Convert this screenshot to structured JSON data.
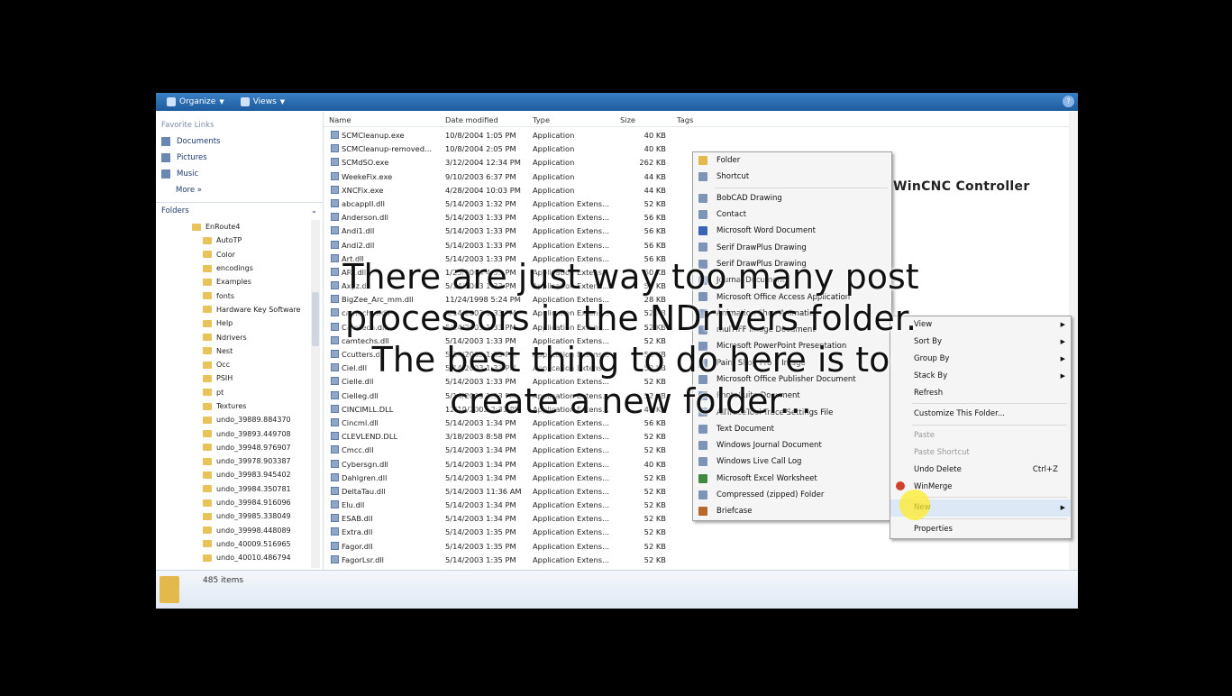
{
  "toolbar": {
    "organize": "Organize",
    "views": "Views",
    "help": "?"
  },
  "nav": {
    "favorite_links_label": "Favorite Links",
    "favorites": [
      "Documents",
      "Pictures",
      "Music"
    ],
    "more": "More »",
    "folders_label": "Folders",
    "tree": [
      {
        "label": "EnRoute4",
        "depth": 0
      },
      {
        "label": "AutoTP",
        "depth": 1
      },
      {
        "label": "Color",
        "depth": 1
      },
      {
        "label": "encodings",
        "depth": 1
      },
      {
        "label": "Examples",
        "depth": 1
      },
      {
        "label": "fonts",
        "depth": 1
      },
      {
        "label": "Hardware Key Software",
        "depth": 1
      },
      {
        "label": "Help",
        "depth": 1
      },
      {
        "label": "Ndrivers",
        "depth": 1
      },
      {
        "label": "Nest",
        "depth": 1
      },
      {
        "label": "Occ",
        "depth": 1
      },
      {
        "label": "PSIH",
        "depth": 1
      },
      {
        "label": "pt",
        "depth": 1
      },
      {
        "label": "Textures",
        "depth": 1
      },
      {
        "label": "undo_39889.884370",
        "depth": 1
      },
      {
        "label": "undo_39893.449708",
        "depth": 1
      },
      {
        "label": "undo_39948.976907",
        "depth": 1
      },
      {
        "label": "undo_39978.903387",
        "depth": 1
      },
      {
        "label": "undo_39983.945402",
        "depth": 1
      },
      {
        "label": "undo_39984.350781",
        "depth": 1
      },
      {
        "label": "undo_39984.916096",
        "depth": 1
      },
      {
        "label": "undo_39985.338049",
        "depth": 1
      },
      {
        "label": "undo_39998.448089",
        "depth": 1
      },
      {
        "label": "undo_40009.516965",
        "depth": 1
      },
      {
        "label": "undo_40010.486794",
        "depth": 1
      }
    ]
  },
  "columns": {
    "name": "Name",
    "date": "Date modified",
    "type": "Type",
    "size": "Size",
    "tags": "Tags"
  },
  "files": [
    {
      "name": "SCMCleanup.exe",
      "date": "10/8/2004 1:05 PM",
      "type": "Application",
      "size": "40 KB"
    },
    {
      "name": "SCMCleanup-removed...",
      "date": "10/8/2004 2:05 PM",
      "type": "Application",
      "size": "40 KB"
    },
    {
      "name": "SCMdSO.exe",
      "date": "3/12/2004 12:34 PM",
      "type": "Application",
      "size": "262 KB"
    },
    {
      "name": "WeekeFix.exe",
      "date": "9/10/2003 6:37 PM",
      "type": "Application",
      "size": "44 KB"
    },
    {
      "name": "XNCFix.exe",
      "date": "4/28/2004 10:03 PM",
      "type": "Application",
      "size": "44 KB"
    },
    {
      "name": "abcappII.dll",
      "date": "5/14/2003 1:32 PM",
      "type": "Application Extens...",
      "size": "52 KB"
    },
    {
      "name": "Anderson.dll",
      "date": "5/14/2003 1:33 PM",
      "type": "Application Extens...",
      "size": "56 KB"
    },
    {
      "name": "Andi1.dll",
      "date": "5/14/2003 1:33 PM",
      "type": "Application Extens...",
      "size": "56 KB"
    },
    {
      "name": "Andi2.dll",
      "date": "5/14/2003 1:33 PM",
      "type": "Application Extens...",
      "size": "56 KB"
    },
    {
      "name": "Art.dll",
      "date": "5/14/2003 1:33 PM",
      "type": "Application Extens...",
      "size": "56 KB"
    },
    {
      "name": "ARt.dll",
      "date": "1/25/2004 4:53 PM",
      "type": "Application Extens...",
      "size": "60 KB"
    },
    {
      "name": "Axyz.dll",
      "date": "5/14/2003 1:33 PM",
      "type": "Application Extens...",
      "size": "56 KB"
    },
    {
      "name": "BigZee_Arc_mm.dll",
      "date": "11/24/1998 5:24 PM",
      "type": "Application Extens...",
      "size": "28 KB"
    },
    {
      "name": "camechss.dll",
      "date": "5/14/2003 1:33 PM",
      "type": "Application Extens...",
      "size": "52 KB"
    },
    {
      "name": "Camtech.dll",
      "date": "5/14/2003 1:33 PM",
      "type": "Application Extens...",
      "size": "52 KB"
    },
    {
      "name": "camtechs.dll",
      "date": "5/14/2003 1:33 PM",
      "type": "Application Extens...",
      "size": "52 KB"
    },
    {
      "name": "Ccutters.dll",
      "date": "5/14/2003 1:33 PM",
      "type": "Application Extens...",
      "size": "52 KB"
    },
    {
      "name": "Ciel.dll",
      "date": "5/14/2003 1:33 PM",
      "type": "Application Extens...",
      "size": "52 KB"
    },
    {
      "name": "Cielle.dll",
      "date": "5/14/2003 1:33 PM",
      "type": "Application Extens...",
      "size": "52 KB"
    },
    {
      "name": "Cielleg.dll",
      "date": "5/14/2003 1:33 PM",
      "type": "Application Extens...",
      "size": "52 KB"
    },
    {
      "name": "CINCIMLL.DLL",
      "date": "12/19/2002 2:31 PM",
      "type": "Application Extens...",
      "size": "44 KB"
    },
    {
      "name": "Cincml.dll",
      "date": "5/14/2003 1:34 PM",
      "type": "Application Extens...",
      "size": "56 KB"
    },
    {
      "name": "CLEVLEND.DLL",
      "date": "3/18/2003 8:58 PM",
      "type": "Application Extens...",
      "size": "52 KB"
    },
    {
      "name": "Cmcc.dll",
      "date": "5/14/2003 1:34 PM",
      "type": "Application Extens...",
      "size": "52 KB"
    },
    {
      "name": "Cybersgn.dll",
      "date": "5/14/2003 1:34 PM",
      "type": "Application Extens...",
      "size": "40 KB"
    },
    {
      "name": "Dahlgren.dll",
      "date": "5/14/2003 1:34 PM",
      "type": "Application Extens...",
      "size": "52 KB"
    },
    {
      "name": "DeltaTau.dll",
      "date": "5/14/2003 11:36 AM",
      "type": "Application Extens...",
      "size": "52 KB"
    },
    {
      "name": "Elu.dll",
      "date": "5/14/2003 1:34 PM",
      "type": "Application Extens...",
      "size": "52 KB"
    },
    {
      "name": "ESAB.dll",
      "date": "5/14/2003 1:34 PM",
      "type": "Application Extens...",
      "size": "52 KB"
    },
    {
      "name": "Extra.dll",
      "date": "5/14/2003 1:35 PM",
      "type": "Application Extens...",
      "size": "52 KB"
    },
    {
      "name": "Fagor.dll",
      "date": "5/14/2003 1:35 PM",
      "type": "Application Extens...",
      "size": "52 KB"
    },
    {
      "name": "FagorLsr.dll",
      "date": "5/14/2003 1:35 PM",
      "type": "Application Extens...",
      "size": "52 KB"
    }
  ],
  "status": {
    "item_count": "485 items"
  },
  "logo": {
    "text": "WinCNC Controller"
  },
  "new_submenu": {
    "items": [
      {
        "label": "Folder",
        "icon": "folder-icon"
      },
      {
        "label": "Shortcut",
        "icon": "shortcut-icon"
      },
      {
        "sep": true
      },
      {
        "label": "BobCAD Drawing",
        "icon": "bobcad-icon"
      },
      {
        "label": "Contact",
        "icon": "contact-icon"
      },
      {
        "label": "Microsoft Word Document",
        "icon": "word-icon"
      },
      {
        "label": "Serif DrawPlus Drawing",
        "icon": "drawplus-icon"
      },
      {
        "label": "Serif DrawPlus Drawing",
        "icon": "drawplus-icon"
      },
      {
        "label": "Journal Document",
        "icon": "journal-icon"
      },
      {
        "label": "Microsoft Office Access Application",
        "icon": "access-icon"
      },
      {
        "label": "Animation Shop Animation",
        "icon": "animation-icon"
      },
      {
        "label": "mulTIFF Image Document",
        "icon": "tiff-icon"
      },
      {
        "label": "Microsoft PowerPoint Presentation",
        "icon": "powerpoint-icon"
      },
      {
        "label": "Paint Shop Pro 5 Image",
        "icon": "paintshop-icon"
      },
      {
        "label": "Microsoft Office Publisher Document",
        "icon": "publisher-icon"
      },
      {
        "label": "PhotoSuite Document",
        "icon": "photosuite-icon"
      },
      {
        "label": "AllTraceTool Trace Settings File",
        "icon": "trace-icon"
      },
      {
        "label": "Text Document",
        "icon": "text-icon"
      },
      {
        "label": "Windows Journal Document",
        "icon": "journal-icon"
      },
      {
        "label": "Windows Live Call Log",
        "icon": "calllog-icon"
      },
      {
        "label": "Microsoft Excel Worksheet",
        "icon": "excel-icon"
      },
      {
        "label": "Compressed (zipped) Folder",
        "icon": "zip-icon"
      },
      {
        "label": "Briefcase",
        "icon": "briefcase-icon"
      }
    ]
  },
  "context_menu": {
    "items": [
      {
        "label": "View",
        "arrow": true
      },
      {
        "label": "Sort By",
        "arrow": true
      },
      {
        "label": "Group By",
        "arrow": true
      },
      {
        "label": "Stack By",
        "arrow": true
      },
      {
        "label": "Refresh"
      },
      {
        "sep": true
      },
      {
        "label": "Customize This Folder..."
      },
      {
        "sep": true
      },
      {
        "label": "Paste",
        "disabled": true
      },
      {
        "label": "Paste Shortcut",
        "disabled": true
      },
      {
        "label": "Undo Delete",
        "shortcut": "Ctrl+Z"
      },
      {
        "label": "WinMerge",
        "icon": true
      },
      {
        "sep": true
      },
      {
        "label": "New",
        "arrow": true,
        "highlight": true
      },
      {
        "sep": true
      },
      {
        "label": "Properties"
      }
    ]
  },
  "caption": {
    "line1": "There are just way too many post",
    "line2": "processors in the NDrivers folder.",
    "line3": "The best thing to do here is to",
    "line4": "create a new folder..."
  }
}
